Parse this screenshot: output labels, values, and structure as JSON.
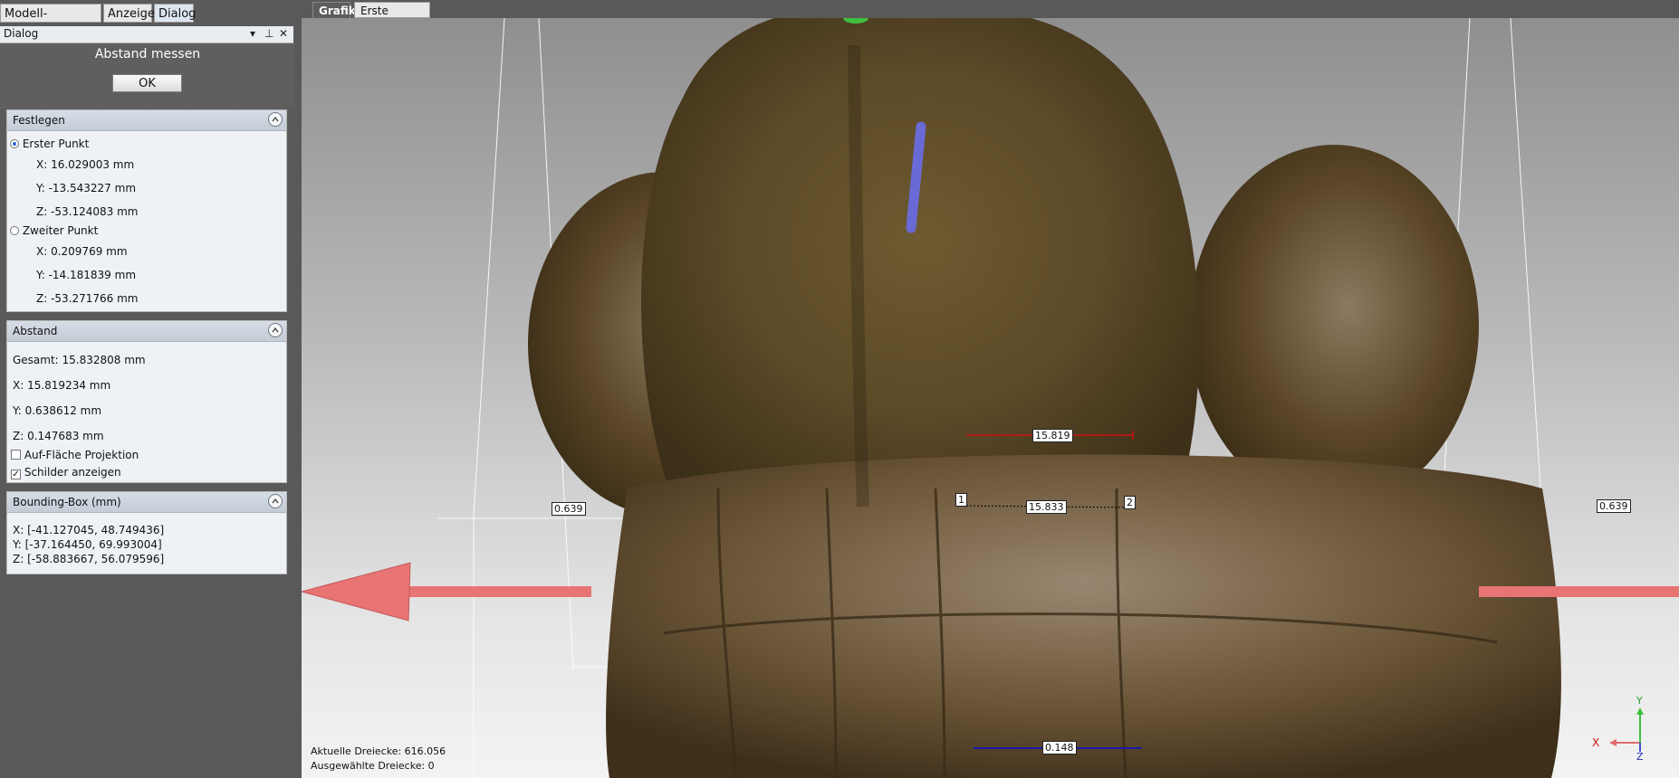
{
  "top_tabs": [
    "Modell-Verwaltung",
    "Anzeige",
    "Dialog"
  ],
  "dialog_bar": {
    "title": "Dialog"
  },
  "dialog": {
    "title": "Abstand messen",
    "ok_label": "OK"
  },
  "festlegen": {
    "title": "Festlegen",
    "first_point": {
      "label": "Erster Punkt",
      "x": "X: 16.029003 mm",
      "y": "Y: -13.543227 mm",
      "z": "Z: -53.124083 mm"
    },
    "second_point": {
      "label": "Zweiter Punkt",
      "x": "X: 0.209769 mm",
      "y": "Y: -14.181839 mm",
      "z": "Z: -53.271766 mm"
    }
  },
  "abstand": {
    "title": "Abstand",
    "gesamt": "Gesamt: 15.832808 mm",
    "x": "X: 15.819234 mm",
    "y": "Y: 0.638612 mm",
    "z": "Z: 0.147683 mm",
    "projection_label": "Auf-Fläche Projektion",
    "projection_checked": false,
    "labels_label": "Schilder anzeigen",
    "labels_checked": true
  },
  "bbox": {
    "title": "Bounding-Box (mm)",
    "x": "X: [-41.127045, 48.749436]",
    "y": "Y: [-37.164450, 69.993004]",
    "z": "Z: [-58.883667, 56.079596]"
  },
  "main_tabs": [
    "Grafik",
    "Erste Schritte"
  ],
  "viewport": {
    "labels": {
      "x_measure": "15.819",
      "total_measure": "15.833",
      "z_measure": "0.148",
      "y_left": "0.639",
      "y_right": "0.639",
      "point1": "1",
      "point2": "2"
    },
    "status": {
      "triangles": "Aktuelle Dreiecke: 616.056",
      "selected": "Ausgewählte Dreiecke: 0"
    },
    "axes": {
      "x": "X",
      "y": "Y",
      "z": "Z"
    }
  },
  "colors": {
    "accent": "#2b6bd6",
    "x_axis": "#e06a6a",
    "measure_red": "#cc1111",
    "measure_blue": "#1a1aa8"
  }
}
